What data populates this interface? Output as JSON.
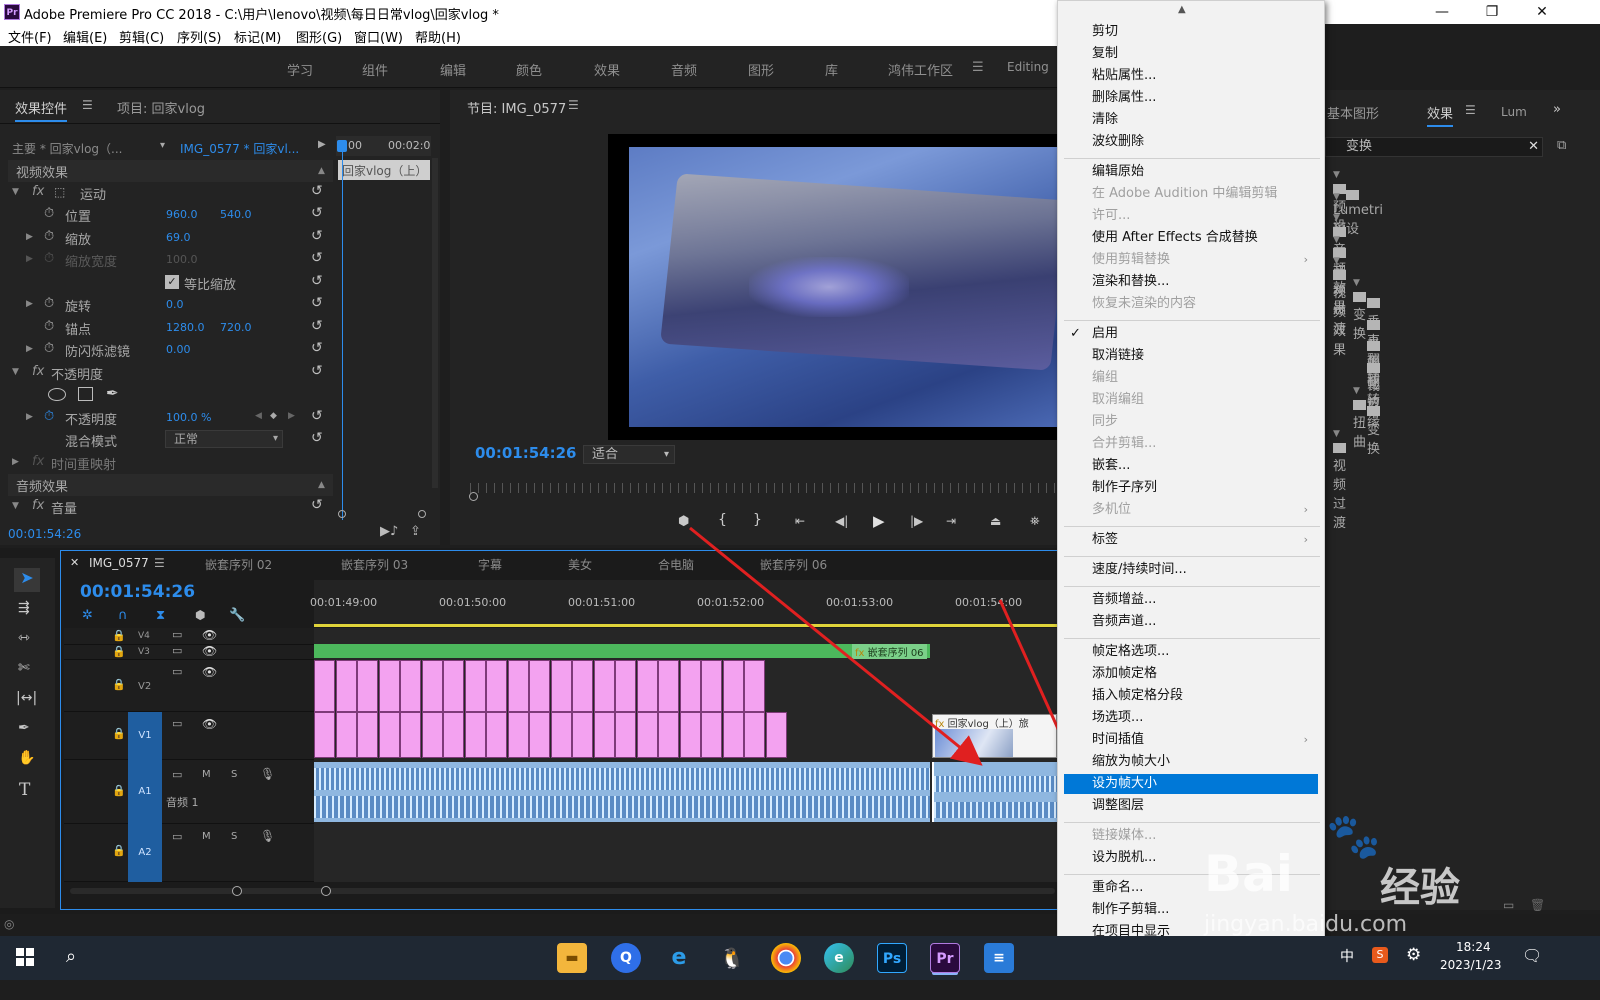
{
  "window": {
    "title": "Adobe Premiere Pro CC 2018 - C:\\用户\\lenovo\\视频\\每日日常vlog\\回家vlog *",
    "app_icon": "Pr",
    "min": "—",
    "max": "❐",
    "close": "✕"
  },
  "menu": [
    "文件(F)",
    "编辑(E)",
    "剪辑(C)",
    "序列(S)",
    "标记(M)",
    "图形(G)",
    "窗口(W)",
    "帮助(H)"
  ],
  "workspaces": [
    "学习",
    "组件",
    "编辑",
    "颜色",
    "效果",
    "音频",
    "图形",
    "库",
    "鸿伟工作区",
    "Editing"
  ],
  "effect_controls": {
    "tab": "效果控件",
    "project_tab": "项目: 回家vlog",
    "master": "主要 * 回家vlog（...",
    "clip": "IMG_0577 * 回家vl...",
    "mini_time1": "00",
    "mini_time2": "00:02:0",
    "mini_clip": "回家vlog（上）",
    "video_effects": "视频效果",
    "audio_effects": "音频效果",
    "motion": "运动",
    "position": "位置",
    "position_x": "960.0",
    "position_y": "540.0",
    "scale": "缩放",
    "scale_v": "69.0",
    "scale_w": "缩放宽度",
    "scale_w_v": "100.0",
    "uniform": "等比缩放",
    "rotation": "旋转",
    "rotation_v": "0.0",
    "anchor": "锚点",
    "anchor_x": "1280.0",
    "anchor_y": "720.0",
    "anti_flicker": "防闪烁滤镜",
    "anti_flicker_v": "0.00",
    "opacity_section": "不透明度",
    "opacity": "不透明度",
    "opacity_v": "100.0 %",
    "blend": "混合模式",
    "blend_v": "正常",
    "time_remap": "时间重映射",
    "volume": "音量",
    "timecode": "00:01:54:26"
  },
  "program": {
    "tab": "节目: IMG_0577",
    "timecode": "00:01:54:26",
    "fit": "适合"
  },
  "right_panel": {
    "tab_graphics": "基本图形",
    "tab_effects": "效果",
    "tab_lum": "Lum",
    "search": "变换",
    "items": [
      {
        "label": "预设",
        "indent": 0
      },
      {
        "label": "Lumetri 预设",
        "indent": 0
      },
      {
        "label": "音频效果",
        "indent": 0
      },
      {
        "label": "音频过渡",
        "indent": 0
      },
      {
        "label": "视频效果",
        "indent": 0
      },
      {
        "label": "变换",
        "indent": 1
      },
      {
        "label": "垂直翻转",
        "indent": 2
      },
      {
        "label": "水平翻转",
        "indent": 2
      },
      {
        "label": "羽化边缘",
        "indent": 2
      },
      {
        "label": "裁剪",
        "indent": 2
      },
      {
        "label": "扭曲",
        "indent": 1
      },
      {
        "label": "变换",
        "indent": 2
      },
      {
        "label": "视频过渡",
        "indent": 0
      }
    ]
  },
  "timeline": {
    "tabs": [
      "IMG_0577",
      "嵌套序列 02",
      "嵌套序列 03",
      "字幕",
      "美女",
      "合电脑",
      "嵌套序列 06"
    ],
    "timecode": "00:01:54:26",
    "ruler": [
      "00:01:49:00",
      "00:01:50:00",
      "00:01:51:00",
      "00:01:52:00",
      "00:01:53:00",
      "00:01:54:00"
    ],
    "tracks": [
      "V4",
      "V3",
      "V2",
      "V1",
      "A1",
      "A2"
    ],
    "audio1_name": "音频 1",
    "nested_clip": "嵌套序列 06",
    "v1_clip": "回家vlog（上）旅",
    "m": "M",
    "s": "S"
  },
  "context_menu": {
    "highlighted": "设为帧大小",
    "items": [
      {
        "label": "剪切",
        "state": "normal"
      },
      {
        "label": "复制",
        "state": "normal"
      },
      {
        "label": "粘贴属性...",
        "state": "normal"
      },
      {
        "label": "删除属性...",
        "state": "normal"
      },
      {
        "label": "清除",
        "state": "normal"
      },
      {
        "label": "波纹删除",
        "state": "normal"
      },
      {
        "label": "编辑原始",
        "state": "normal"
      },
      {
        "label": "在 Adobe Audition 中编辑剪辑",
        "state": "disabled"
      },
      {
        "label": "许可...",
        "state": "disabled"
      },
      {
        "label": "使用 After Effects 合成替换",
        "state": "normal"
      },
      {
        "label": "使用剪辑替换",
        "state": "disabled"
      },
      {
        "label": "渲染和替换...",
        "state": "normal"
      },
      {
        "label": "恢复未渲染的内容",
        "state": "disabled"
      },
      {
        "label": "启用",
        "state": "checked"
      },
      {
        "label": "取消链接",
        "state": "normal"
      },
      {
        "label": "编组",
        "state": "disabled"
      },
      {
        "label": "取消编组",
        "state": "disabled"
      },
      {
        "label": "同步",
        "state": "disabled"
      },
      {
        "label": "合并剪辑...",
        "state": "disabled"
      },
      {
        "label": "嵌套...",
        "state": "normal"
      },
      {
        "label": "制作子序列",
        "state": "normal"
      },
      {
        "label": "多机位",
        "state": "disabled"
      },
      {
        "label": "标签",
        "state": "normal"
      },
      {
        "label": "速度/持续时间...",
        "state": "normal"
      },
      {
        "label": "音频增益...",
        "state": "normal"
      },
      {
        "label": "音频声道...",
        "state": "normal"
      },
      {
        "label": "帧定格选项...",
        "state": "normal"
      },
      {
        "label": "添加帧定格",
        "state": "normal"
      },
      {
        "label": "插入帧定格分段",
        "state": "normal"
      },
      {
        "label": "场选项...",
        "state": "normal"
      },
      {
        "label": "时间插值",
        "state": "normal"
      },
      {
        "label": "缩放为帧大小",
        "state": "normal"
      },
      {
        "label": "设为帧大小",
        "state": "highlighted"
      },
      {
        "label": "调整图层",
        "state": "normal"
      },
      {
        "label": "链接媒体...",
        "state": "disabled"
      },
      {
        "label": "设为脱机...",
        "state": "normal"
      },
      {
        "label": "重命名...",
        "state": "normal"
      },
      {
        "label": "制作子剪辑...",
        "state": "normal"
      },
      {
        "label": "在项目中显示",
        "state": "normal"
      }
    ]
  },
  "taskbar": {
    "time": "18:24",
    "date": "2023/1/23",
    "ime": "中"
  },
  "watermark": {
    "brand": "Bai",
    "brand2": "经验",
    "url": "jingyan.baidu.com"
  },
  "colors": {
    "accent_blue": "#2d8ceb",
    "menu_highlight": "#0078d7",
    "clip_pink": "#f3a2f0",
    "clip_green": "#4cb85c",
    "audio_blue": "#7fa0c8",
    "arrow_red": "#e02020"
  }
}
